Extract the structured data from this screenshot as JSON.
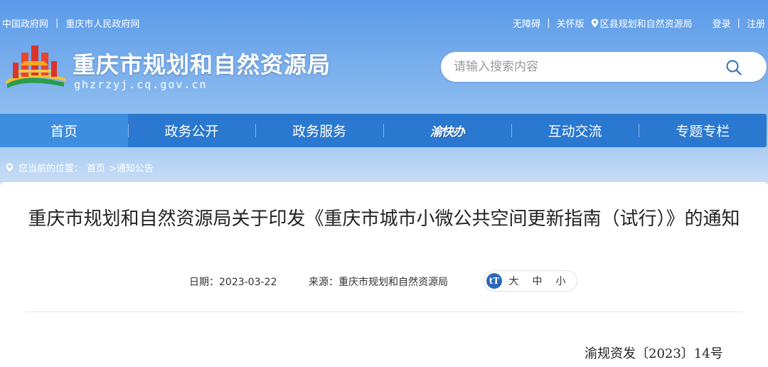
{
  "topbar": {
    "links_left": [
      "中国政府网",
      "重庆市人民政府网"
    ],
    "accessibility": "无障碍",
    "care_mode": "关怀版",
    "district": "区县规划和自然资源局",
    "login": "登录",
    "register": "注册"
  },
  "header": {
    "site_name": "重庆市规划和自然资源局",
    "domain": "ghzrzyj.cq.gov.cn"
  },
  "search": {
    "placeholder": "请输入搜索内容"
  },
  "nav": {
    "items": [
      {
        "label": "首页",
        "active": true
      },
      {
        "label": "政务公开"
      },
      {
        "label": "政务服务"
      },
      {
        "label": "渝快办"
      },
      {
        "label": "互动交流"
      },
      {
        "label": "专题专栏"
      }
    ]
  },
  "breadcrumb": {
    "prefix": "您当前的位置：",
    "home": "首页",
    "current": ">通知公告"
  },
  "article": {
    "title": "重庆市规划和自然资源局关于印发《重庆市城市小微公共空间更新指南（试行）》的通知",
    "date_label": "日期：2023-03-22",
    "source_label": "来源：重庆市规划和自然资源局",
    "font_size_options": [
      "大",
      "中",
      "小"
    ],
    "doc_number": "渝规资发〔2023〕14号"
  },
  "colors": {
    "nav_bg": "#2a78cf",
    "nav_active": "#3d8de0",
    "header_top": "#5a9ae8"
  }
}
